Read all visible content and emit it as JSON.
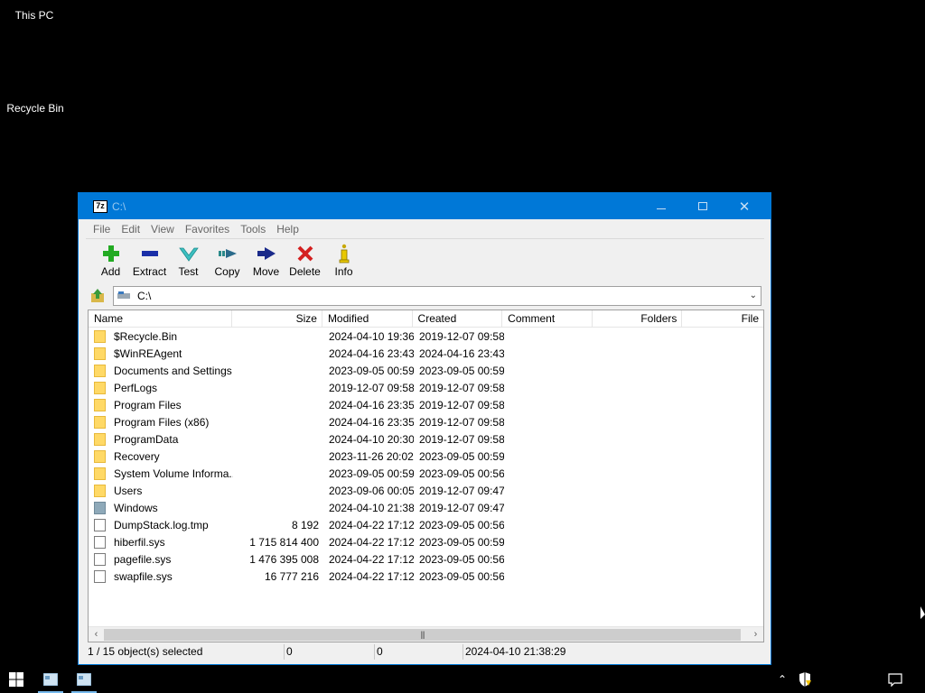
{
  "desktop": {
    "icons": [
      {
        "label": "This PC"
      },
      {
        "label": "Recycle Bin"
      }
    ]
  },
  "window": {
    "title": "C:\\",
    "app_badge": "7z",
    "menu": [
      "File",
      "Edit",
      "View",
      "Favorites",
      "Tools",
      "Help"
    ],
    "toolbar": [
      {
        "label": "Add",
        "icon": "plus-icon",
        "color": "#22aa22"
      },
      {
        "label": "Extract",
        "icon": "minus-icon",
        "color": "#1a2fa8"
      },
      {
        "label": "Test",
        "icon": "check-icon",
        "color": "#3cbfc0"
      },
      {
        "label": "Copy",
        "icon": "copy-arrow-icon",
        "color": "#2a8a8a"
      },
      {
        "label": "Move",
        "icon": "move-arrow-icon",
        "color": "#1a2a8a"
      },
      {
        "label": "Delete",
        "icon": "x-icon",
        "color": "#d42020"
      },
      {
        "label": "Info",
        "icon": "info-icon",
        "color": "#c8a800"
      }
    ],
    "address": {
      "path": "C:\\"
    },
    "columns": {
      "name": "Name",
      "size": "Size",
      "modified": "Modified",
      "created": "Created",
      "comment": "Comment",
      "folders": "Folders",
      "files": "File"
    },
    "rows": [
      {
        "name": "$Recycle.Bin",
        "type": "folder",
        "size": "",
        "modified": "2024-04-10 19:36",
        "created": "2019-12-07 09:58"
      },
      {
        "name": "$WinREAgent",
        "type": "folder",
        "size": "",
        "modified": "2024-04-16 23:43",
        "created": "2024-04-16 23:43"
      },
      {
        "name": "Documents and Settings",
        "type": "folder",
        "size": "",
        "modified": "2023-09-05 00:59",
        "created": "2023-09-05 00:59"
      },
      {
        "name": "PerfLogs",
        "type": "folder",
        "size": "",
        "modified": "2019-12-07 09:58",
        "created": "2019-12-07 09:58"
      },
      {
        "name": "Program Files",
        "type": "folder",
        "size": "",
        "modified": "2024-04-16 23:35",
        "created": "2019-12-07 09:58"
      },
      {
        "name": "Program Files (x86)",
        "type": "folder",
        "size": "",
        "modified": "2024-04-16 23:35",
        "created": "2019-12-07 09:58"
      },
      {
        "name": "ProgramData",
        "type": "folder",
        "size": "",
        "modified": "2024-04-10 20:30",
        "created": "2019-12-07 09:58"
      },
      {
        "name": "Recovery",
        "type": "folder",
        "size": "",
        "modified": "2023-11-26 20:02",
        "created": "2023-09-05 00:59"
      },
      {
        "name": "System Volume Informa...",
        "type": "folder",
        "size": "",
        "modified": "2023-09-05 00:59",
        "created": "2023-09-05 00:56"
      },
      {
        "name": "Users",
        "type": "folder",
        "size": "",
        "modified": "2023-09-06 00:05",
        "created": "2019-12-07 09:47"
      },
      {
        "name": "Windows",
        "type": "folder-sys",
        "size": "",
        "modified": "2024-04-10 21:38",
        "created": "2019-12-07 09:47"
      },
      {
        "name": "DumpStack.log.tmp",
        "type": "file",
        "size": "8 192",
        "modified": "2024-04-22 17:12",
        "created": "2023-09-05 00:56"
      },
      {
        "name": "hiberfil.sys",
        "type": "file",
        "size": "1 715 814 400",
        "modified": "2024-04-22 17:12",
        "created": "2023-09-05 00:59"
      },
      {
        "name": "pagefile.sys",
        "type": "file",
        "size": "1 476 395 008",
        "modified": "2024-04-22 17:12",
        "created": "2023-09-05 00:56"
      },
      {
        "name": "swapfile.sys",
        "type": "file",
        "size": "16 777 216",
        "modified": "2024-04-22 17:12",
        "created": "2023-09-05 00:56"
      }
    ],
    "status": {
      "selection": "1 / 15 object(s) selected",
      "size": "0",
      "packed": "0",
      "date": "2024-04-10 21:38:29"
    }
  },
  "colors": {
    "titlebar": "#0078d7",
    "accent": "#76b9ed"
  }
}
